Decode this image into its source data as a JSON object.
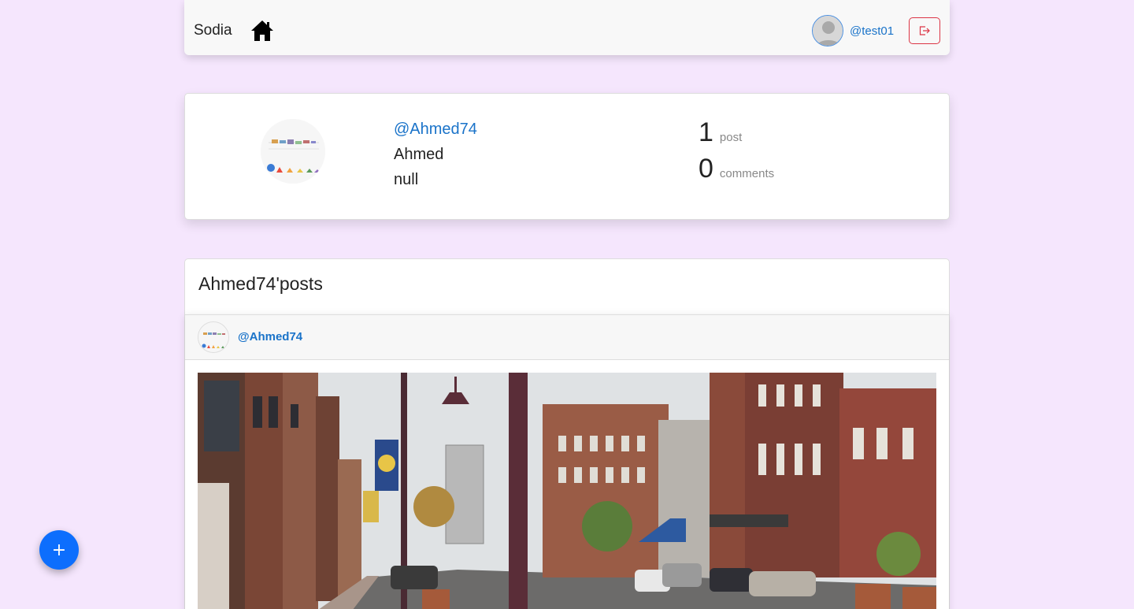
{
  "navbar": {
    "brand": "Sodia",
    "home_icon": "home-icon",
    "user_handle": "@test01",
    "logout_icon": "logout-icon"
  },
  "profile": {
    "handle": "@Ahmed74",
    "name": "Ahmed",
    "bio": "null",
    "stats": {
      "posts_count": "1",
      "posts_label": "post",
      "comments_count": "0",
      "comments_label": "comments"
    }
  },
  "posts_section": {
    "title": "Ahmed74'posts",
    "posts": [
      {
        "author": "@Ahmed74",
        "image": "street-photo"
      }
    ]
  },
  "fab": {
    "label": "+"
  },
  "colors": {
    "background": "#f5e6fd",
    "link": "#1a73c9",
    "danger": "#dc3545",
    "primary": "#0d6efd"
  }
}
